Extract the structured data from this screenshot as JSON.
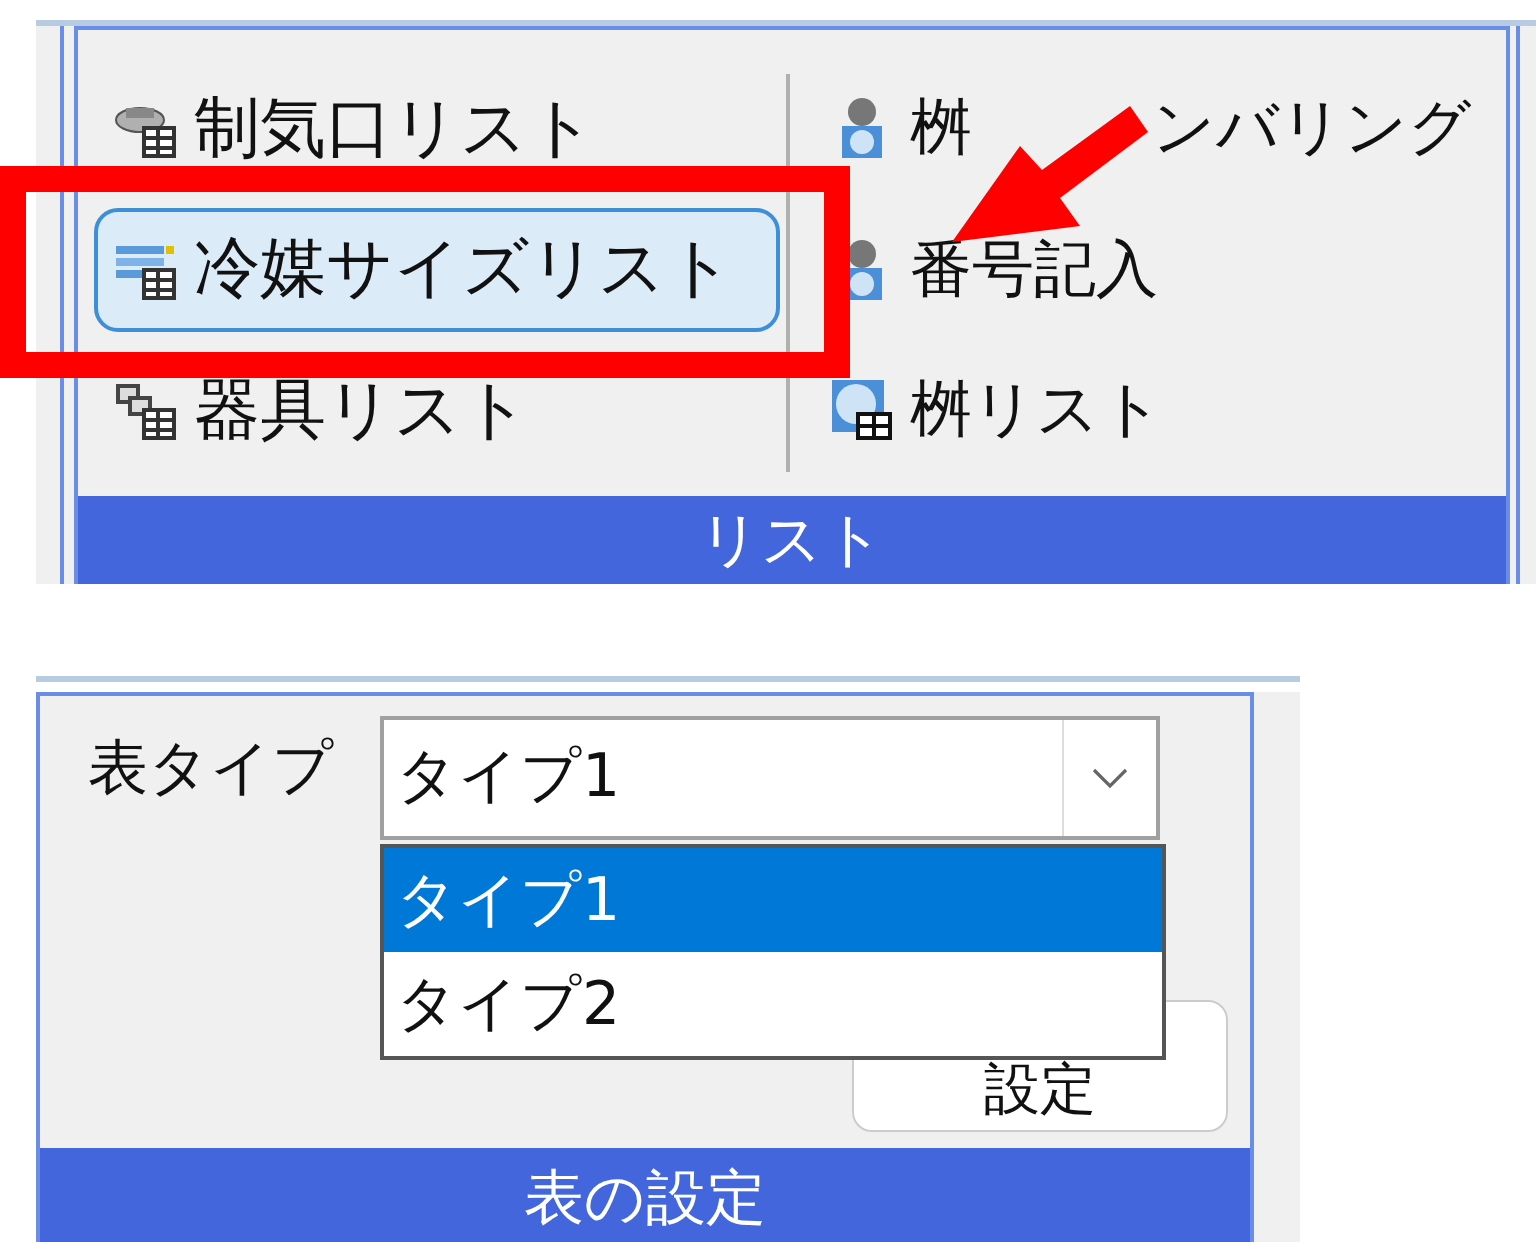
{
  "ribbon_group": {
    "left_items": [
      {
        "label": "制気口リスト",
        "kind": "vent",
        "selected": false
      },
      {
        "label": "冷媒サイズリスト",
        "kind": "refrigerant",
        "selected": true
      },
      {
        "label": "器具リスト",
        "kind": "fixture",
        "selected": false
      }
    ],
    "right_items": [
      {
        "label_segments": [
          "桝",
          "ンバリング"
        ],
        "kind": "figure"
      },
      {
        "label": "番号記入",
        "kind": "figure"
      },
      {
        "label": "桝リスト",
        "kind": "basin"
      }
    ],
    "footer": "リスト"
  },
  "table_settings": {
    "field_label": "表タイプ",
    "combo_value": "タイプ1",
    "options": [
      {
        "label": "タイプ1",
        "selected": true
      },
      {
        "label": "タイプ2",
        "selected": false
      }
    ],
    "button": "設定",
    "footer": "表の設定"
  }
}
